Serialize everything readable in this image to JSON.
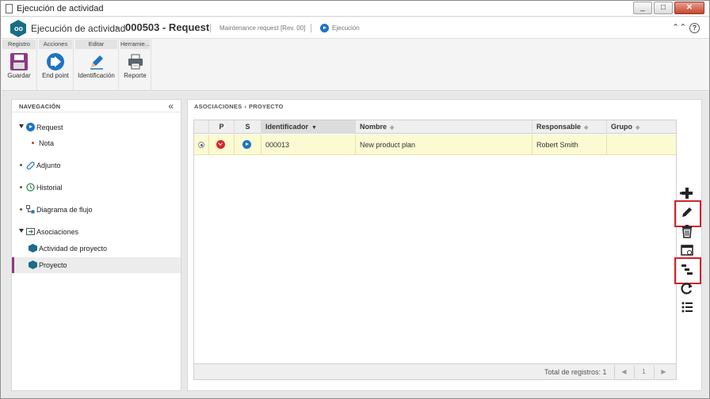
{
  "window": {
    "title": "Ejecución de actividad",
    "buttons": [
      "_",
      "□",
      "✕"
    ]
  },
  "header": {
    "title": "Ejecución de actividad",
    "separator": "›",
    "record": "000503 - Request",
    "subtitle": "Maintenance request [Rev. 00]",
    "state": "Ejecución"
  },
  "ribbon": {
    "groups": [
      {
        "label": "Registro",
        "button": "Guardar",
        "icon": "save-icon"
      },
      {
        "label": "Acciones",
        "button": "End point",
        "icon": "end-point-icon"
      },
      {
        "label": "Editar",
        "button": "Identificación",
        "icon": "pencil-icon"
      },
      {
        "label": "Herramie...",
        "button": "Reporte",
        "icon": "printer-icon"
      }
    ]
  },
  "nav": {
    "heading": "NAVEGACIÓN",
    "items": [
      {
        "label": "Request"
      },
      {
        "label": "Nota"
      },
      {
        "label": "Adjunto"
      },
      {
        "label": "Historial"
      },
      {
        "label": "Diagrama de flujo"
      },
      {
        "label": "Asociaciones"
      },
      {
        "label": "Actividad de proyecto"
      },
      {
        "label": "Proyecto"
      }
    ]
  },
  "panel": {
    "breadcrumb": [
      "ASOCIACIONES",
      "PROYECTO"
    ],
    "columns": {
      "p": "P",
      "s": "S",
      "id": "Identificador",
      "name": "Nombre",
      "resp": "Responsable",
      "group": "Grupo"
    },
    "rows": [
      {
        "id": "000013",
        "name": "New product plan",
        "resp": "Robert Smith",
        "group": ""
      }
    ],
    "footer": {
      "total": "Total de registros: 1",
      "page": "1"
    }
  },
  "toolbar_icons": [
    "add-icon",
    "edit-icon",
    "delete-icon",
    "view-icon",
    "hierarchy-icon",
    "refresh-icon",
    "list-icon"
  ],
  "colors": {
    "accent": "#8b3a86",
    "blue": "#1e74c3",
    "highlight": "#d0252b",
    "row_selected": "#fbfad3"
  }
}
